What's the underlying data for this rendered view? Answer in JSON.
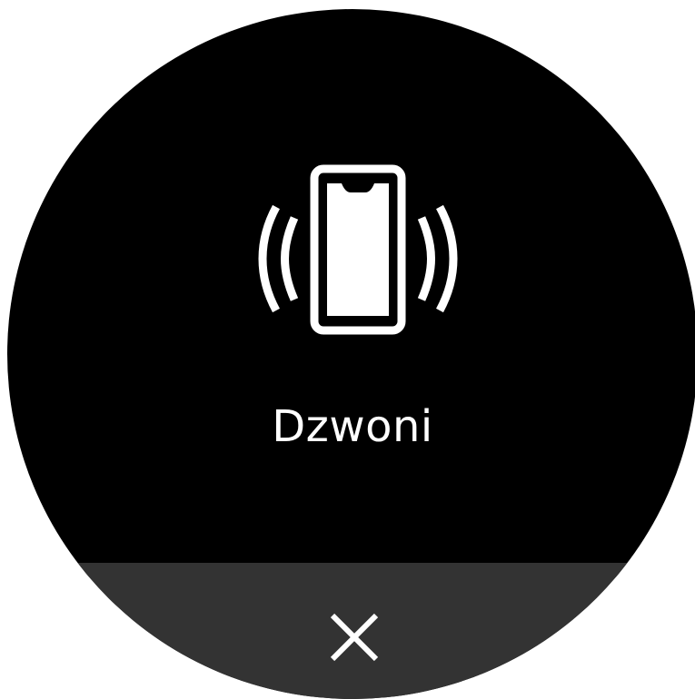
{
  "screen": {
    "title": "Dzwoni",
    "icon": "phone-ringing-icon",
    "dismiss_icon": "close-icon"
  },
  "colors": {
    "background": "#000000",
    "foreground": "#ffffff",
    "dismiss_bar": "#333333"
  }
}
